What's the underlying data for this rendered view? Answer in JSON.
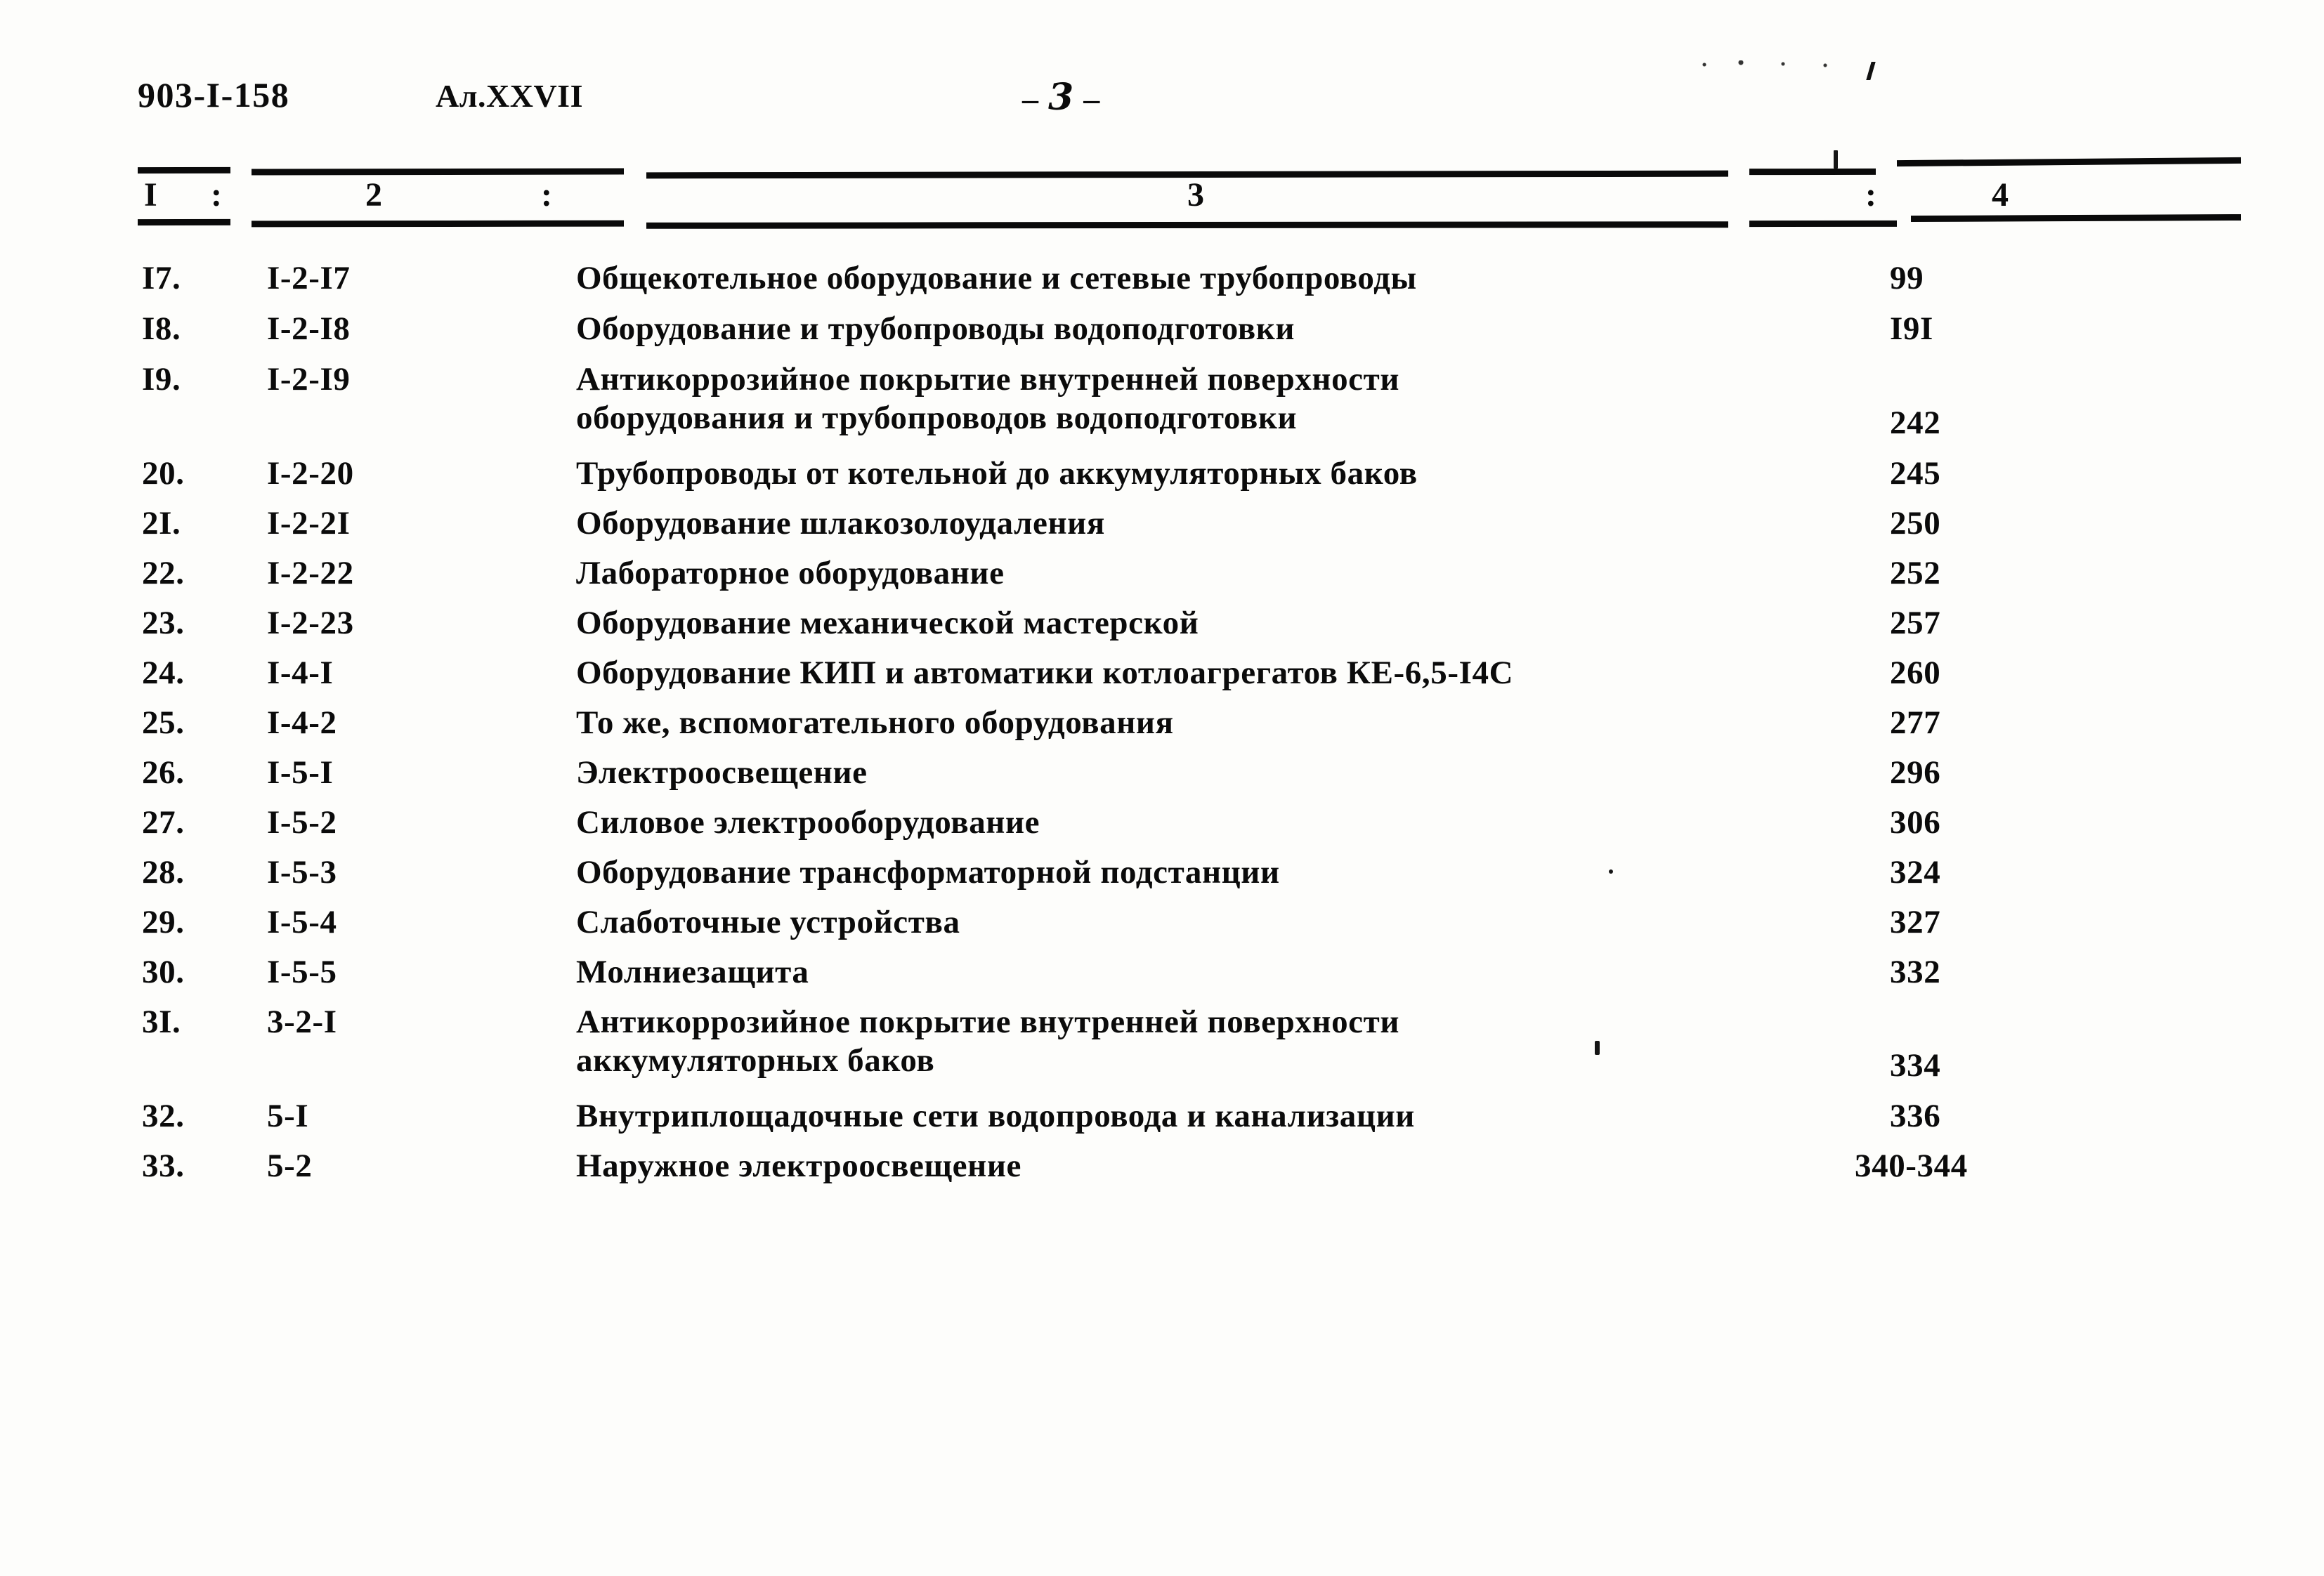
{
  "header": {
    "doc_code": "903-I-158",
    "album_code": "Ал.XXVII",
    "folio_left_dash": "–",
    "folio_number": "3",
    "folio_right_dash": "–"
  },
  "table": {
    "column_numbers": {
      "col1": "I",
      "sep1": ":",
      "col2": "2",
      "sep2": ":",
      "col3": "3",
      "sep3": ":",
      "col4": "4"
    },
    "rows": [
      {
        "no": "I7.",
        "code": "I-2-I7",
        "desc_line1": "Общекотельное оборудование и сетевые трубопроводы",
        "desc_line2": "",
        "page": "99"
      },
      {
        "no": "I8.",
        "code": "I-2-I8",
        "desc_line1": "Оборудование и трубопроводы водоподготовки",
        "desc_line2": "",
        "page": "I9I"
      },
      {
        "no": "I9.",
        "code": "I-2-I9",
        "desc_line1": "Антикоррозийное покрытие внутренней поверхности",
        "desc_line2": "оборудования и трубопроводов водоподготовки",
        "page": "242"
      },
      {
        "no": "20.",
        "code": "I-2-20",
        "desc_line1": "Трубопроводы от котельной до аккумуляторных баков",
        "desc_line2": "",
        "page": "245"
      },
      {
        "no": "2I.",
        "code": "I-2-2I",
        "desc_line1": "Оборудование шлакозолоудаления",
        "desc_line2": "",
        "page": "250"
      },
      {
        "no": "22.",
        "code": "I-2-22",
        "desc_line1": "Лабораторное оборудование",
        "desc_line2": "",
        "page": "252"
      },
      {
        "no": "23.",
        "code": "I-2-23",
        "desc_line1": "Оборудование механической мастерской",
        "desc_line2": "",
        "page": "257"
      },
      {
        "no": "24.",
        "code": "I-4-I",
        "desc_line1": "Оборудование КИП и автоматики котлоагрегатов КЕ-6,5-I4С",
        "desc_line2": "",
        "page": "260"
      },
      {
        "no": "25.",
        "code": "I-4-2",
        "desc_line1": "То же, вспомогательного оборудования",
        "desc_line2": "",
        "page": "277"
      },
      {
        "no": "26.",
        "code": "I-5-I",
        "desc_line1": "Электроосвещение",
        "desc_line2": "",
        "page": "296"
      },
      {
        "no": "27.",
        "code": "I-5-2",
        "desc_line1": "Силовое электрооборудование",
        "desc_line2": "",
        "page": "306"
      },
      {
        "no": "28.",
        "code": "I-5-3",
        "desc_line1": "Оборудование трансформаторной подстанции",
        "desc_line2": "",
        "page": "324"
      },
      {
        "no": "29.",
        "code": "I-5-4",
        "desc_line1": "Слаботочные устройства",
        "desc_line2": "",
        "page": "327"
      },
      {
        "no": "30.",
        "code": "I-5-5",
        "desc_line1": "Молниезащита",
        "desc_line2": "",
        "page": "332"
      },
      {
        "no": "3I.",
        "code": "3-2-I",
        "desc_line1": "Антикоррозийное покрытие внутренней поверхности",
        "desc_line2": "аккумуляторных баков",
        "page": "334"
      },
      {
        "no": "32.",
        "code": "5-I",
        "desc_line1": "Внутриплощадочные сети водопровода и канализации",
        "desc_line2": "",
        "page": "336"
      },
      {
        "no": "33.",
        "code": "5-2",
        "desc_line1": "Наружное электроосвещение",
        "desc_line2": "",
        "page": "340-344"
      }
    ]
  }
}
